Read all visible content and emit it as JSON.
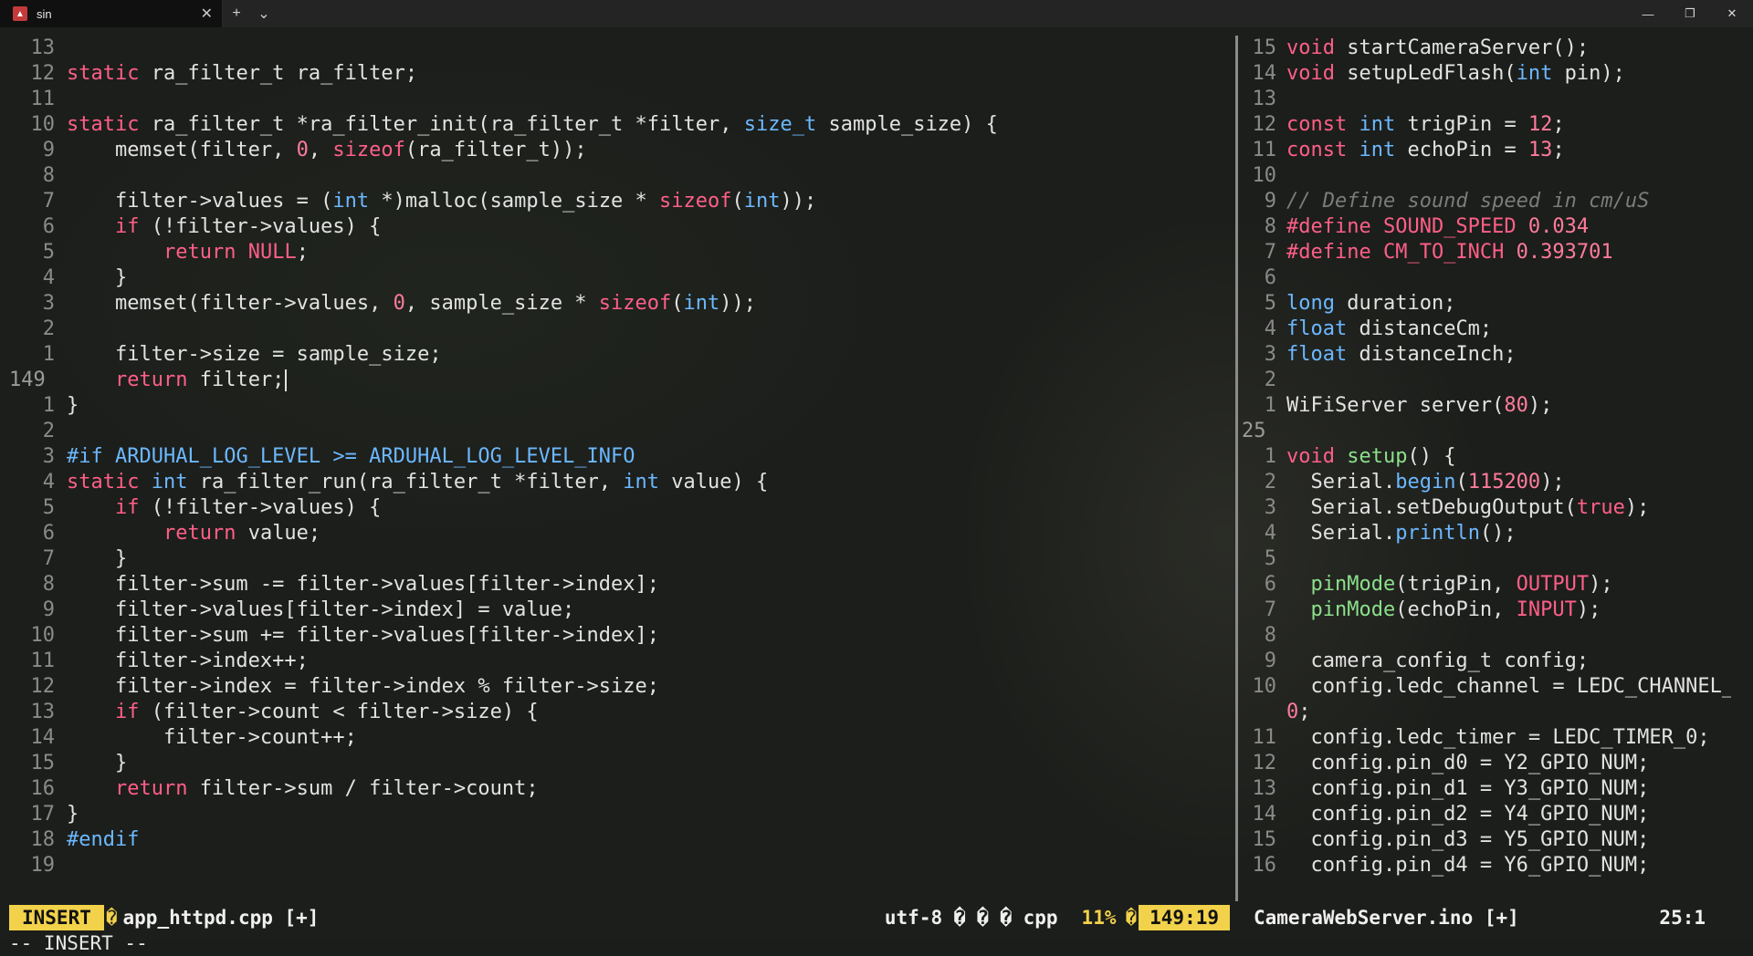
{
  "window": {
    "tab_title": "sin",
    "tab_icon": "terminal-app-icon",
    "buttons": {
      "new_tab": "+",
      "dropdown": "⌄",
      "close_tab": "✕",
      "minimize": "—",
      "restore": "❐",
      "close": "✕"
    }
  },
  "left_pane": {
    "lines": [
      {
        "n": "13",
        "t": ""
      },
      {
        "n": "12",
        "t": "static ra_filter_t ra_filter;"
      },
      {
        "n": "11",
        "t": ""
      },
      {
        "n": "10",
        "t": "static ra_filter_t *ra_filter_init(ra_filter_t *filter, size_t sample_size) {"
      },
      {
        "n": "9",
        "t": "    memset(filter, 0, sizeof(ra_filter_t));"
      },
      {
        "n": "8",
        "t": ""
      },
      {
        "n": "7",
        "t": "    filter->values = (int *)malloc(sample_size * sizeof(int));"
      },
      {
        "n": "6",
        "t": "    if (!filter->values) {"
      },
      {
        "n": "5",
        "t": "        return NULL;"
      },
      {
        "n": "4",
        "t": "    }"
      },
      {
        "n": "3",
        "t": "    memset(filter->values, 0, sample_size * sizeof(int));"
      },
      {
        "n": "2",
        "t": ""
      },
      {
        "n": "1",
        "t": "    filter->size = sample_size;"
      },
      {
        "n": "149",
        "t": "    return filter;",
        "cur": true
      },
      {
        "n": "1",
        "t": "}"
      },
      {
        "n": "2",
        "t": ""
      },
      {
        "n": "3",
        "t": "#if ARDUHAL_LOG_LEVEL >= ARDUHAL_LOG_LEVEL_INFO"
      },
      {
        "n": "4",
        "t": "static int ra_filter_run(ra_filter_t *filter, int value) {"
      },
      {
        "n": "5",
        "t": "    if (!filter->values) {"
      },
      {
        "n": "6",
        "t": "        return value;"
      },
      {
        "n": "7",
        "t": "    }"
      },
      {
        "n": "8",
        "t": "    filter->sum -= filter->values[filter->index];"
      },
      {
        "n": "9",
        "t": "    filter->values[filter->index] = value;"
      },
      {
        "n": "10",
        "t": "    filter->sum += filter->values[filter->index];"
      },
      {
        "n": "11",
        "t": "    filter->index++;"
      },
      {
        "n": "12",
        "t": "    filter->index = filter->index % filter->size;"
      },
      {
        "n": "13",
        "t": "    if (filter->count < filter->size) {"
      },
      {
        "n": "14",
        "t": "        filter->count++;"
      },
      {
        "n": "15",
        "t": "    }"
      },
      {
        "n": "16",
        "t": "    return filter->sum / filter->count;"
      },
      {
        "n": "17",
        "t": "}"
      },
      {
        "n": "18",
        "t": "#endif"
      },
      {
        "n": "19",
        "t": ""
      }
    ]
  },
  "right_pane": {
    "lines": [
      {
        "n": "15",
        "t": "void startCameraServer();"
      },
      {
        "n": "14",
        "t": "void setupLedFlash(int pin);"
      },
      {
        "n": "13",
        "t": ""
      },
      {
        "n": "12",
        "t": "const int trigPin = 12;"
      },
      {
        "n": "11",
        "t": "const int echoPin = 13;"
      },
      {
        "n": "10",
        "t": ""
      },
      {
        "n": "9",
        "t": "// Define sound speed in cm/uS"
      },
      {
        "n": "8",
        "t": "#define SOUND_SPEED 0.034"
      },
      {
        "n": "7",
        "t": "#define CM_TO_INCH 0.393701"
      },
      {
        "n": "6",
        "t": ""
      },
      {
        "n": "5",
        "t": "long duration;"
      },
      {
        "n": "4",
        "t": "float distanceCm;"
      },
      {
        "n": "3",
        "t": "float distanceInch;"
      },
      {
        "n": "2",
        "t": ""
      },
      {
        "n": "1",
        "t": "WiFiServer server(80);"
      },
      {
        "n": "25",
        "t": "",
        "cur": true
      },
      {
        "n": "1",
        "t": "void setup() {"
      },
      {
        "n": "2",
        "t": "  Serial.begin(115200);"
      },
      {
        "n": "3",
        "t": "  Serial.setDebugOutput(true);"
      },
      {
        "n": "4",
        "t": "  Serial.println();"
      },
      {
        "n": "5",
        "t": ""
      },
      {
        "n": "6",
        "t": "  pinMode(trigPin, OUTPUT);"
      },
      {
        "n": "7",
        "t": "  pinMode(echoPin, INPUT);"
      },
      {
        "n": "8",
        "t": ""
      },
      {
        "n": "9",
        "t": "  camera_config_t config;"
      },
      {
        "n": "10",
        "t": "  config.ledc_channel = LEDC_CHANNEL_"
      },
      {
        "n": "",
        "t": "0;"
      },
      {
        "n": "11",
        "t": "  config.ledc_timer = LEDC_TIMER_0;"
      },
      {
        "n": "12",
        "t": "  config.pin_d0 = Y2_GPIO_NUM;"
      },
      {
        "n": "13",
        "t": "  config.pin_d1 = Y3_GPIO_NUM;"
      },
      {
        "n": "14",
        "t": "  config.pin_d2 = Y4_GPIO_NUM;"
      },
      {
        "n": "15",
        "t": "  config.pin_d3 = Y5_GPIO_NUM;"
      },
      {
        "n": "16",
        "t": "  config.pin_d4 = Y6_GPIO_NUM;"
      }
    ]
  },
  "status_left": {
    "mode": "INSERT",
    "sep": "�",
    "filename": "app_httpd.cpp [+]",
    "encoding": "utf-8 � � � cpp",
    "percent_sep": "",
    "percent": "11%",
    "position_sep": "�",
    "position": "149:19"
  },
  "status_right": {
    "filename": "CameraWebServer.ino [+]",
    "position": "25:1"
  },
  "command_line": "-- INSERT --",
  "colors": {
    "keyword": "#ff5f87",
    "type": "#6cb8ff",
    "number": "#ff7b9c",
    "comment": "#7c7c7c",
    "function": "#8ce08a",
    "mode_bg": "#f2d24a"
  }
}
